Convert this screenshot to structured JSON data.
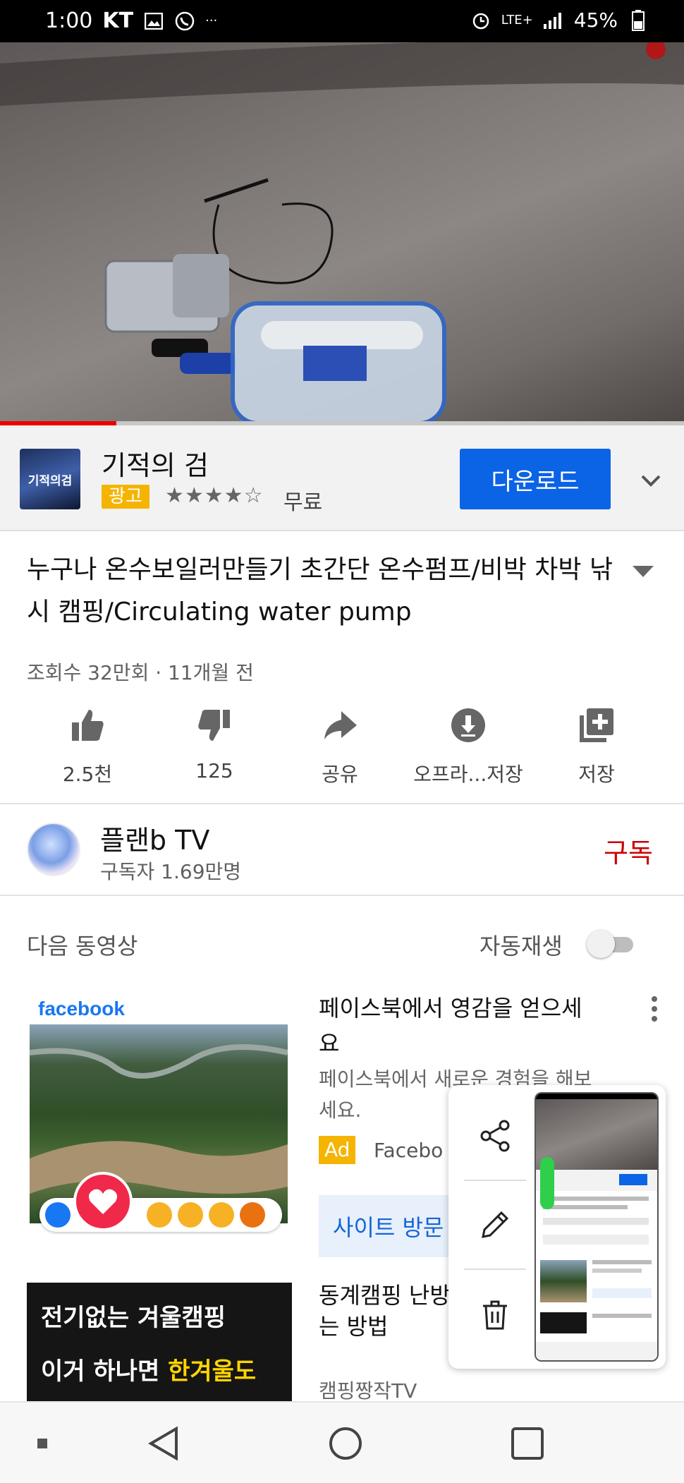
{
  "status_bar": {
    "time": "1:00",
    "carrier": "KT",
    "more": "···",
    "network": "LTE+",
    "battery": "45%"
  },
  "video": {
    "progress_percent": 17
  },
  "ad": {
    "app_name": "기적의 검",
    "thumb_text": "기적의검",
    "badge": "광고",
    "rating_stars": "★★★★☆",
    "price": "무료",
    "download_label": "다운로드"
  },
  "video_info": {
    "title": "누구나 온수보일러만들기 초간단 온수펌프/비박 차박 낚시 캠핑/Circulating water pump",
    "meta": "조회수 32만회 · 11개월 전",
    "actions": {
      "like": "2.5천",
      "dislike": "125",
      "share": "공유",
      "offline": "오프라...저장",
      "save": "저장"
    }
  },
  "channel": {
    "name": "플랜b TV",
    "subscribers": "구독자 1.69만명",
    "subscribe_label": "구독"
  },
  "up_next": {
    "label": "다음 동영상",
    "autoplay_label": "자동재생",
    "autoplay_on": false
  },
  "fb_ad": {
    "logo": "facebook",
    "title": "페이스북에서 영감을 얻으세요",
    "description": "페이스북에서 새로운 경험을 해보세요.",
    "badge": "Ad",
    "advertiser": "Facebo",
    "cta": "사이트 방문"
  },
  "video2": {
    "thumb_line1": "전기없는 겨울캠핑",
    "thumb_line2_prefix": "이거 하나면 ",
    "thumb_line2_highlight": "한겨울도",
    "title": "동계캠핑 난방 전기없어도 캠핑하는 방법",
    "channel": "캠핑짱작TV"
  },
  "colors": {
    "accent_blue": "#0b63e5",
    "subscribe_red": "#cc0000",
    "ad_yellow": "#f5b400",
    "facebook_blue": "#1877f2"
  }
}
